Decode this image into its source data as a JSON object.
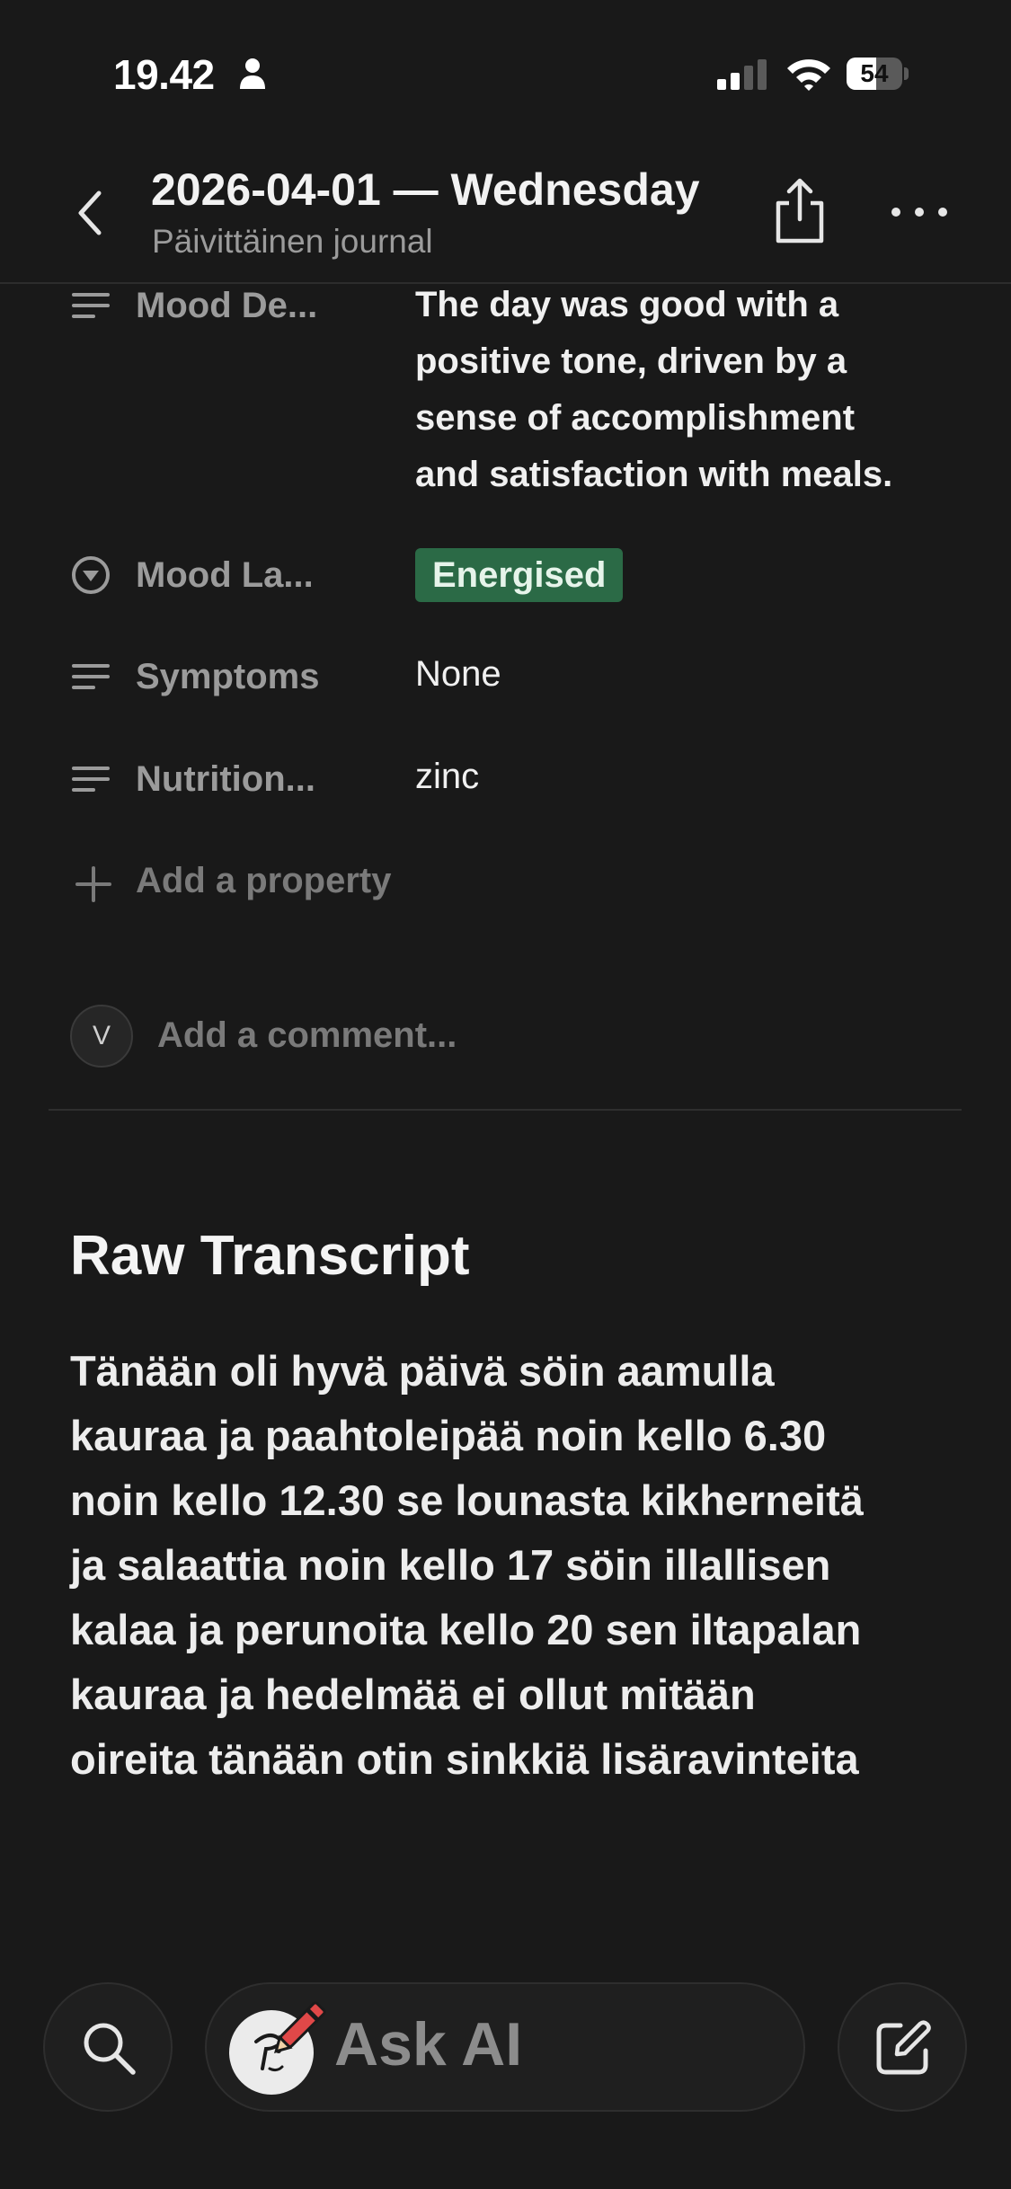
{
  "status_bar": {
    "time": "19.42",
    "battery_level": "54",
    "battery_fraction": 0.54
  },
  "header": {
    "title": "2026-04-01 — Wednesday",
    "subtitle": "Päivittäinen journal",
    "icons": [
      "chevron-left-icon",
      "share-icon",
      "more-icon"
    ]
  },
  "properties": [
    {
      "label": "Mood De...",
      "icon": "text-lines-icon",
      "value_lines": [
        "The day was good with a",
        "positive tone, driven by a",
        "sense of accomplishment",
        "and satisfaction with meals."
      ]
    },
    {
      "label": "Mood La...",
      "icon": "select-circle-icon",
      "value": "Energised",
      "tag_color": "#2b6a46"
    },
    {
      "label": "Symptoms",
      "icon": "text-lines-icon",
      "value": "None"
    },
    {
      "label": "Nutrition...",
      "icon": "text-lines-icon",
      "value": "zinc"
    }
  ],
  "add_property": {
    "label": "Add a property",
    "icon": "plus-icon"
  },
  "comment": {
    "avatar_initial": "V",
    "placeholder": "Add a comment..."
  },
  "transcript": {
    "heading": "Raw Transcript",
    "lines": [
      "Tänään oli hyvä päivä söin aamulla",
      "kauraa ja paahtoleipää noin kello 6.30",
      "noin kello 12.30 se lounasta kikherneitä",
      "ja salaattia noin kello 17 söin illallisen",
      "kalaa ja perunoita kello 20 sen iltapalan",
      "kauraa ja hedelmää ei ollut mitään",
      "oireita tänään otin sinkkiä lisäravinteita"
    ]
  },
  "bottom_bar": {
    "ask_ai_label": "Ask AI",
    "icons": [
      "search-icon",
      "ai-avatar-icon",
      "compose-icon"
    ]
  },
  "colors": {
    "background": "#191919",
    "tag_green": "#2b6a46",
    "muted_text": "#9b9b9b"
  }
}
